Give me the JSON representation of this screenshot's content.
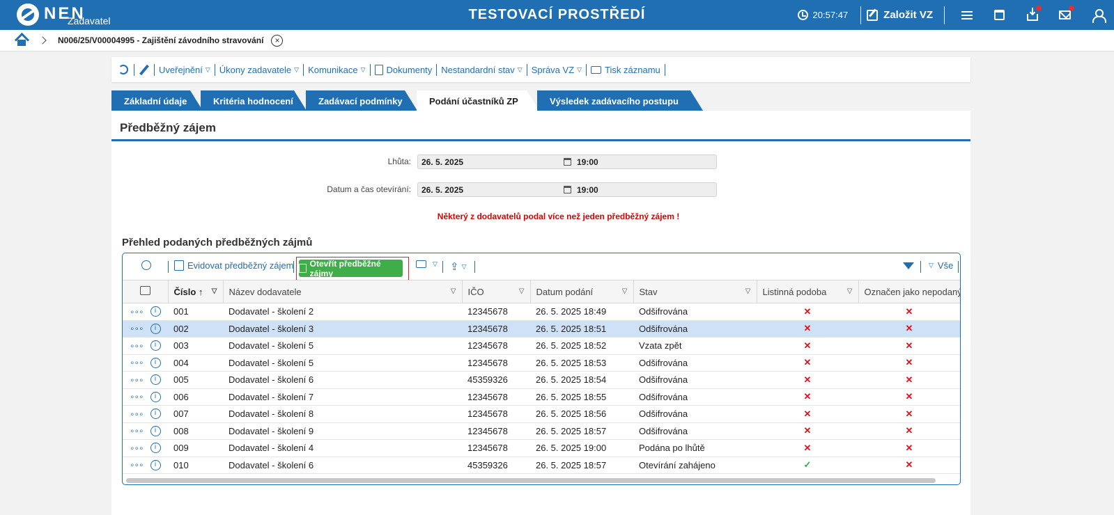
{
  "header": {
    "logo": "NEN",
    "logo_sub": "Zadavatel",
    "env_title": "TESTOVACÍ PROSTŘEDÍ",
    "clock": "20:57:47",
    "create_vz": "Založit VZ",
    "icons": [
      "clock-icon",
      "pen-icon",
      "menu-icon",
      "calendar-icon",
      "download-icon",
      "mail-icon",
      "user-icon"
    ],
    "accent": "#1f6fb2"
  },
  "breadcrumb": {
    "text": "N006/25/V00004995 - Zajištění závodního stravování"
  },
  "actions": {
    "uverejneni": "Uveřejnění",
    "ukony": "Úkony zadavatele",
    "komunikace": "Komunikace",
    "dokumenty": "Dokumenty",
    "nestandardni": "Nestandardní stav",
    "sprava": "Správa VZ",
    "tisk": "Tisk záznamu"
  },
  "tabs": [
    {
      "label": "Základní údaje"
    },
    {
      "label": "Kritéria hodnocení"
    },
    {
      "label": "Zadávací podmínky"
    },
    {
      "label": "Podání účastníků ZP"
    },
    {
      "label": "Výsledek zadávacího postupu"
    }
  ],
  "page": {
    "title": "Předběžný zájem",
    "lhuta_label": "Lhůta:",
    "lhuta_date": "26. 5. 2025",
    "lhuta_time": "19:00",
    "otevirani_label": "Datum a čas otevírání:",
    "otevirani_date": "26. 5. 2025",
    "otevirani_time": "19:00",
    "warning": "Některý z dodavatelů podal více než jeden předběžný zájem !",
    "warning_color": "#e00000",
    "section_title": "Přehled podaných předběžných zájmů"
  },
  "grid": {
    "evidovat": "Evidovat předběžný zájem",
    "otevrit": "Otevřít předběžné zájmy",
    "vse": "Vše",
    "columns": [
      "Číslo",
      "Název dodavatele",
      "IČO",
      "Datum podání",
      "Stav",
      "Listinná podoba",
      "Označen jako nepodaný"
    ],
    "rows": [
      {
        "cislo": "001",
        "nazev": "Dodavatel - školení 2",
        "ico": "12345678",
        "datum": "26. 5. 2025 18:49",
        "stav": "Odšifrována",
        "listinna": "✕",
        "oznacen": "✕"
      },
      {
        "cislo": "002",
        "nazev": "Dodavatel - školení 3",
        "ico": "12345678",
        "datum": "26. 5. 2025 18:51",
        "stav": "Odšifrována",
        "listinna": "✕",
        "oznacen": "✕"
      },
      {
        "cislo": "003",
        "nazev": "Dodavatel - školení 5",
        "ico": "12345678",
        "datum": "26. 5. 2025 18:52",
        "stav": "Vzata zpět",
        "listinna": "✕",
        "oznacen": "✕"
      },
      {
        "cislo": "004",
        "nazev": "Dodavatel - školení 5",
        "ico": "12345678",
        "datum": "26. 5. 2025 18:53",
        "stav": "Odšifrována",
        "listinna": "✕",
        "oznacen": "✕"
      },
      {
        "cislo": "005",
        "nazev": "Dodavatel - školení 6",
        "ico": "45359326",
        "datum": "26. 5. 2025 18:54",
        "stav": "Odšifrována",
        "listinna": "✕",
        "oznacen": "✕"
      },
      {
        "cislo": "006",
        "nazev": "Dodavatel - školení 7",
        "ico": "12345678",
        "datum": "26. 5. 2025 18:55",
        "stav": "Odšifrována",
        "listinna": "✕",
        "oznacen": "✕"
      },
      {
        "cislo": "007",
        "nazev": "Dodavatel - školení 8",
        "ico": "12345678",
        "datum": "26. 5. 2025 18:56",
        "stav": "Odšifrována",
        "listinna": "✕",
        "oznacen": "✕"
      },
      {
        "cislo": "008",
        "nazev": "Dodavatel - školení 9",
        "ico": "12345678",
        "datum": "26. 5. 2025 18:57",
        "stav": "Odšifrována",
        "listinna": "✕",
        "oznacen": "✕"
      },
      {
        "cislo": "009",
        "nazev": "Dodavatel - školení 4",
        "ico": "12345678",
        "datum": "26. 5. 2025 19:00",
        "stav": "Podána po lhůtě",
        "listinna": "✕",
        "oznacen": "✕"
      },
      {
        "cislo": "010",
        "nazev": "Dodavatel - školení 6",
        "ico": "45359326",
        "datum": "26. 5. 2025 18:57",
        "stav": "Otevírání zahájeno",
        "listinna": "✓",
        "oznacen": "✕"
      }
    ]
  }
}
